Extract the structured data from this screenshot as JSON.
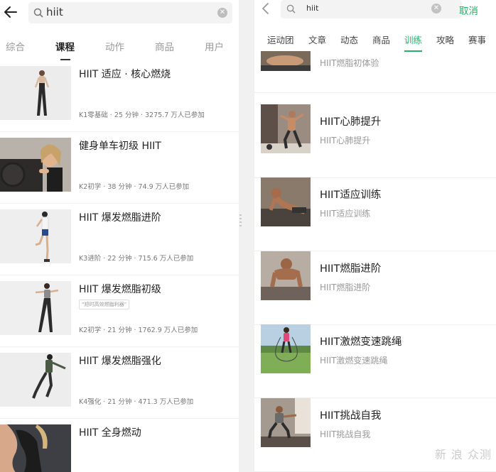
{
  "left": {
    "search": {
      "query": "hiit"
    },
    "tabs": [
      {
        "label": "综合",
        "active": false
      },
      {
        "label": "课程",
        "active": true
      },
      {
        "label": "动作",
        "active": false
      },
      {
        "label": "商品",
        "active": false
      },
      {
        "label": "用户",
        "active": false
      }
    ],
    "courses": [
      {
        "title": "HIIT 适应 · 核心燃烧",
        "meta": "K1零基础 · 25 分钟 · 3275.7 万人已参加",
        "tag": ""
      },
      {
        "title": "健身单车初级 HIIT",
        "meta": "K2初学 · 38 分钟 · 74.9 万人已参加",
        "tag": ""
      },
      {
        "title": "HIIT 爆发燃脂进阶",
        "meta": "K3进阶 · 22 分钟 · 715.6 万人已参加",
        "tag": ""
      },
      {
        "title": "HIIT 爆发燃脂初级",
        "meta": "K2初学 · 21 分钟 · 1762.9 万人已参加",
        "tag": "“短时高效燃脂利器”"
      },
      {
        "title": "HIIT 爆发燃脂强化",
        "meta": "K4强化 · 21 分钟 · 471.3 万人已参加",
        "tag": ""
      },
      {
        "title": "HIIT 全身燃动",
        "meta": "",
        "tag": ""
      }
    ]
  },
  "right": {
    "search": {
      "query": "hiit",
      "cancel_label": "取消"
    },
    "tabs": [
      {
        "label": "运动团",
        "active": false
      },
      {
        "label": "文章",
        "active": false
      },
      {
        "label": "动态",
        "active": false
      },
      {
        "label": "商品",
        "active": false
      },
      {
        "label": "训练",
        "active": true
      },
      {
        "label": "攻略",
        "active": false
      },
      {
        "label": "赛事",
        "active": false
      }
    ],
    "partial_item": {
      "subtitle": "HIIT燃脂初体验"
    },
    "trainings": [
      {
        "title": "HIIT心肺提升",
        "subtitle": "HIIT心肺提升"
      },
      {
        "title": "HIIT适应训练",
        "subtitle": "HIIT适应训练"
      },
      {
        "title": "HIIT燃脂进阶",
        "subtitle": "HIIT燃脂进阶"
      },
      {
        "title": "HIIT激燃变速跳绳",
        "subtitle": "HIIT激燃变速跳绳"
      },
      {
        "title": "HIIT挑战自我",
        "subtitle": "HIIT挑战自我"
      }
    ]
  },
  "watermark": "新 浪 众测",
  "colors": {
    "accent": "#23b26b",
    "text": "#222222",
    "muted": "#999999"
  },
  "icons": [
    "back-arrow-icon",
    "search-icon",
    "clear-icon",
    "chevron-left-icon"
  ]
}
